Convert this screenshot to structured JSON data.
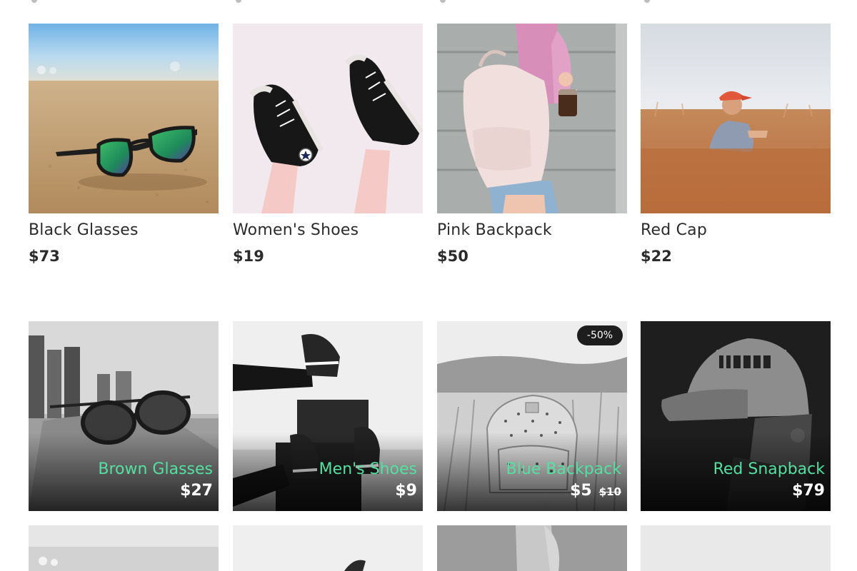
{
  "row1": [
    {
      "name": "Black Glasses",
      "price": "$73"
    },
    {
      "name": "Women's Shoes",
      "price": "$19"
    },
    {
      "name": "Pink Backpack",
      "price": "$50"
    },
    {
      "name": "Red Cap",
      "price": "$22"
    }
  ],
  "row2": [
    {
      "name": "Brown Glasses",
      "price": "$27"
    },
    {
      "name": "Men's Shoes",
      "price": "$9"
    },
    {
      "name": "Blue Backpack",
      "price": "$5",
      "old_price": "$10",
      "badge": "-50%"
    },
    {
      "name": "Red Snapback",
      "price": "$79"
    }
  ],
  "colors": {
    "accent_name": "#53e0a0",
    "text": "#2b2b2b",
    "badge_bg": "#1d1d1d"
  }
}
